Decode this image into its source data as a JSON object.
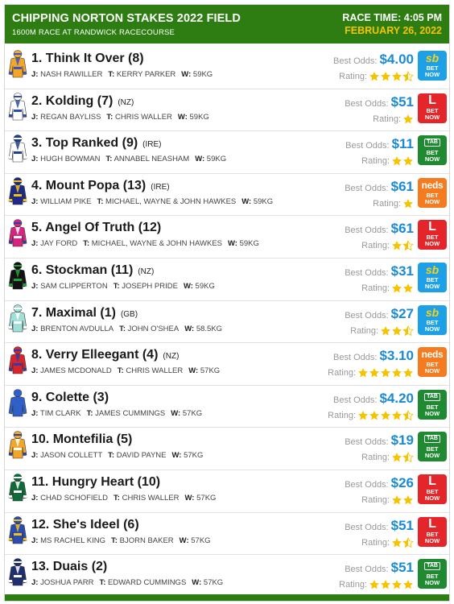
{
  "header": {
    "title": "CHIPPING NORTON STAKES 2022 FIELD",
    "subtitle": "1600M RACE AT RANDWICK RACECOURSE",
    "race_time": "RACE TIME: 4:05 PM",
    "race_date": "FEBRUARY 26, 2022"
  },
  "labels": {
    "best_odds": "Best Odds:",
    "rating": "Rating:",
    "bet": "BET",
    "now": "NOW",
    "jockey": "J:",
    "trainer": "T:",
    "weight": "W:"
  },
  "runners": [
    {
      "name": "1. Think It Over (8)",
      "country": "",
      "jockey": "NASH RAWILLER",
      "trainer": "KERRY PARKER",
      "weight": "59KG",
      "odds": "$4.00",
      "rating": 3.5,
      "bookie": "sb",
      "bookie_logo": "sb",
      "silk": [
        "#f2a72a",
        "#3a55c4",
        "#f2a72a",
        "#3a55c4"
      ]
    },
    {
      "name": "2. Kolding (7)",
      "country": "(NZ)",
      "jockey": "REGAN BAYLISS",
      "trainer": "CHRIS WALLER",
      "weight": "59KG",
      "odds": "$51",
      "rating": 1,
      "bookie": "lb",
      "bookie_logo": "L",
      "silk": [
        "#ffffff",
        "#2b4ea8",
        "#ffffff",
        "#2b4ea8"
      ]
    },
    {
      "name": "3. Top Ranked (9)",
      "country": "(IRE)",
      "jockey": "HUGH BOWMAN",
      "trainer": "ANNABEL NEASHAM",
      "weight": "59KG",
      "odds": "$11",
      "rating": 2,
      "bookie": "tab",
      "bookie_logo": "TAB",
      "silk": [
        "#ffffff",
        "#1e3f8f",
        "#1e3f8f",
        "#ffffff"
      ]
    },
    {
      "name": "4. Mount Popa (13)",
      "country": "(IRE)",
      "jockey": "WILLIAM PIKE",
      "trainer": "MICHAEL, WAYNE & JOHN HAWKES",
      "weight": "59KG",
      "odds": "$61",
      "rating": 1,
      "bookie": "neds",
      "bookie_logo": "neds",
      "silk": [
        "#1d2a8a",
        "#f2c21b",
        "#1d2a8a",
        "#f2c21b"
      ]
    },
    {
      "name": "5. Angel Of Truth (12)",
      "country": "",
      "jockey": "JAY FORD",
      "trainer": "MICHAEL, WAYNE & JOHN HAWKES",
      "weight": "59KG",
      "odds": "$61",
      "rating": 1.5,
      "bookie": "lb",
      "bookie_logo": "L",
      "silk": [
        "#d6257e",
        "#ffffff",
        "#d6257e",
        "#2a3fa8"
      ]
    },
    {
      "name": "6. Stockman (11)",
      "country": "(NZ)",
      "jockey": "SAM CLIPPERTON",
      "trainer": "JOSEPH PRIDE",
      "weight": "59KG",
      "odds": "$31",
      "rating": 2,
      "bookie": "sb",
      "bookie_logo": "sb",
      "silk": [
        "#111111",
        "#22a33a",
        "#111111",
        "#22a33a"
      ]
    },
    {
      "name": "7. Maximal (1)",
      "country": "(GB)",
      "jockey": "BRENTON AVDULLA",
      "trainer": "JOHN O'SHEA",
      "weight": "58.5KG",
      "odds": "$27",
      "rating": 2.5,
      "bookie": "sb",
      "bookie_logo": "sb",
      "silk": [
        "#9fe0d8",
        "#ffffff",
        "#9fe0d8",
        "#ffffff"
      ]
    },
    {
      "name": "8. Verry Elleegant (4)",
      "country": "(NZ)",
      "jockey": "JAMES MCDONALD",
      "trainer": "CHRIS WALLER",
      "weight": "57KG",
      "odds": "$3.10",
      "rating": 5,
      "bookie": "neds",
      "bookie_logo": "neds",
      "silk": [
        "#d8242c",
        "#2a3fa8",
        "#d8242c",
        "#2a3fa8"
      ]
    },
    {
      "name": "9. Colette (3)",
      "country": "",
      "jockey": "TIM CLARK",
      "trainer": "JAMES CUMMINGS",
      "weight": "57KG",
      "odds": "$4.20",
      "rating": 4.5,
      "bookie": "tab",
      "bookie_logo": "TAB",
      "silk": [
        "#2f5fc9",
        "#2f5fc9",
        "#2f5fc9",
        "#2f5fc9"
      ]
    },
    {
      "name": "10. Montefilia (5)",
      "country": "",
      "jockey": "JASON COLLETT",
      "trainer": "DAVID PAYNE",
      "weight": "57KG",
      "odds": "$19",
      "rating": 1.5,
      "bookie": "tab",
      "bookie_logo": "TAB",
      "silk": [
        "#f2a72a",
        "#ffffff",
        "#f2a72a",
        "#2a3fa8"
      ]
    },
    {
      "name": "11. Hungry Heart (10)",
      "country": "",
      "jockey": "CHAD SCHOFIELD",
      "trainer": "CHRIS WALLER",
      "weight": "57KG",
      "odds": "$26",
      "rating": 2,
      "bookie": "lb",
      "bookie_logo": "L",
      "silk": [
        "#0f6b3a",
        "#ffffff",
        "#0f6b3a",
        "#ffffff"
      ]
    },
    {
      "name": "12. She's Ideel (6)",
      "country": "",
      "jockey": "MS RACHEL KING",
      "trainer": "BJORN BAKER",
      "weight": "57KG",
      "odds": "$51",
      "rating": 1.5,
      "bookie": "lb",
      "bookie_logo": "L",
      "silk": [
        "#2a4bb0",
        "#f2c21b",
        "#2a4bb0",
        "#f2c21b"
      ]
    },
    {
      "name": "13. Duais (2)",
      "country": "",
      "jockey": "JOSHUA PARR",
      "trainer": "EDWARD CUMMINGS",
      "weight": "57KG",
      "odds": "$51",
      "rating": 4,
      "bookie": "tab",
      "bookie_logo": "TAB",
      "silk": [
        "#1e2e6e",
        "#ffffff",
        "#1e2e6e",
        "#ffffff"
      ]
    }
  ],
  "colors": {
    "header_bg": "#2e7d12",
    "date": "#f5c400",
    "odds": "#1a8ad4",
    "star": "#f5c400",
    "sb": "#1ea0e6",
    "lb": "#e4262b",
    "tab": "#1f8a32",
    "neds": "#f47b20"
  }
}
